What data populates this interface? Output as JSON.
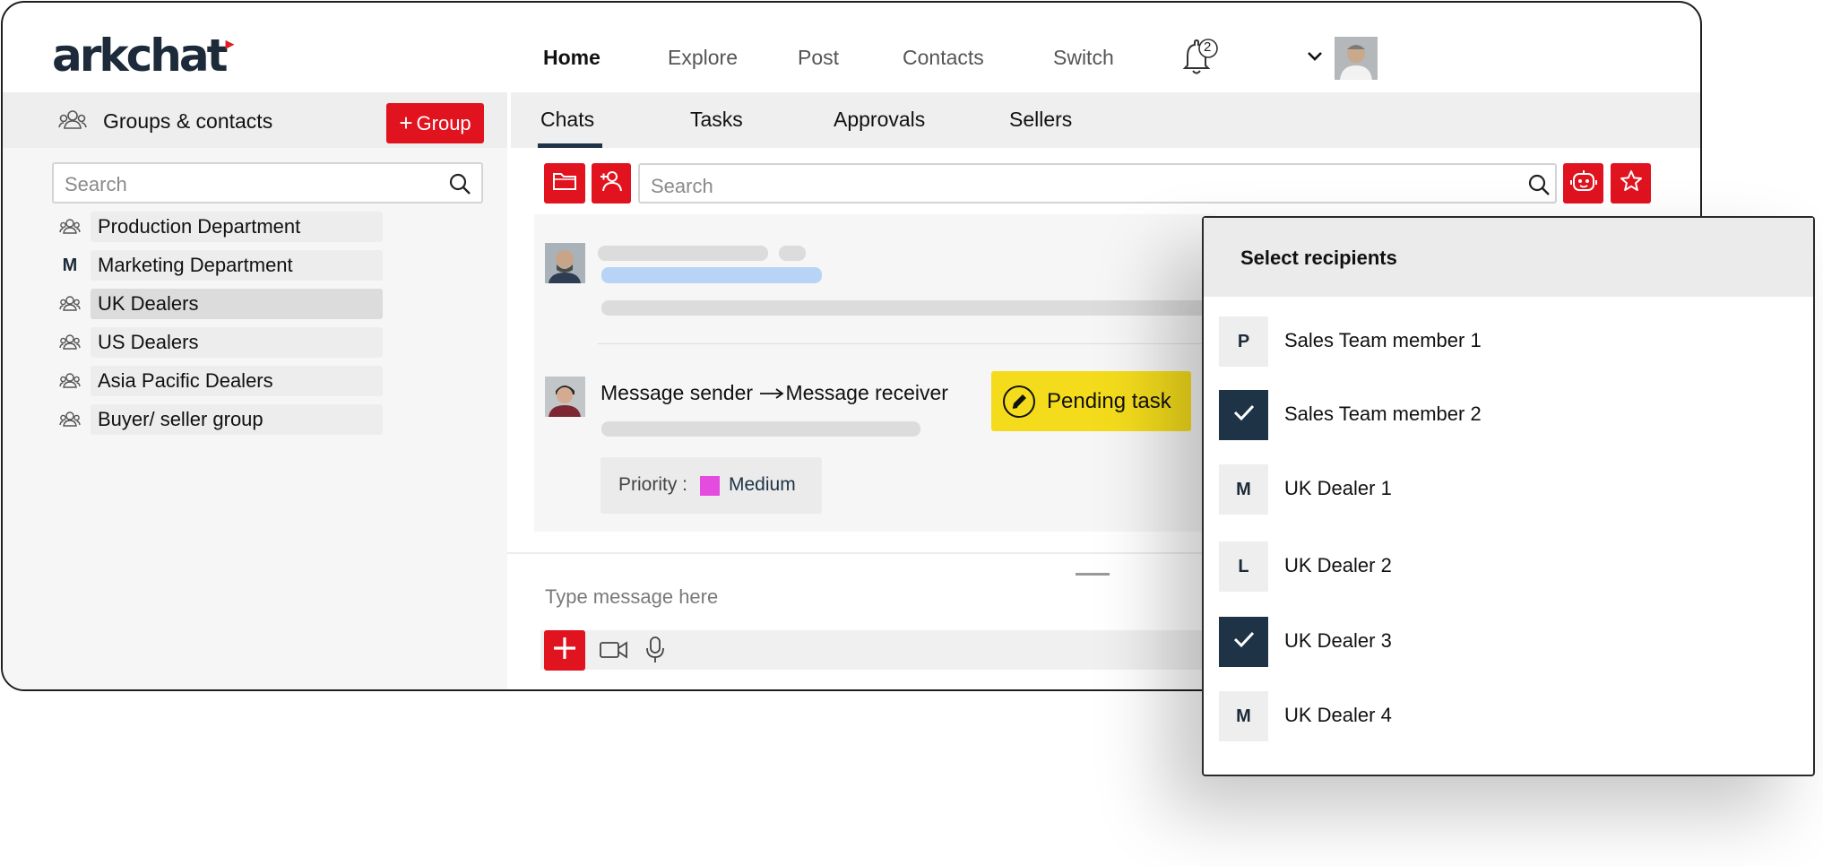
{
  "header": {
    "logo": "arkchat",
    "nav": [
      "Home",
      "Explore",
      "Post",
      "Contacts",
      "Switch"
    ],
    "notification_count": "2"
  },
  "sidebar": {
    "title": "Groups & contacts",
    "add_group_label": "Group",
    "search_placeholder": "Search",
    "items": [
      {
        "label": "Production Department",
        "icon": "group-icon"
      },
      {
        "label": "Marketing Department",
        "icon": "M"
      },
      {
        "label": "UK Dealers",
        "icon": "group-icon"
      },
      {
        "label": "US Dealers",
        "icon": "group-icon"
      },
      {
        "label": "Asia Pacific Dealers",
        "icon": "group-icon"
      },
      {
        "label": "Buyer/ seller group",
        "icon": "group-icon"
      }
    ]
  },
  "main": {
    "tabs": [
      "Chats",
      "Tasks",
      "Approvals",
      "Sellers"
    ],
    "search_placeholder": "Search",
    "message": {
      "sender_text": "Message sender",
      "receiver_text": "Message receiver",
      "task_label": "Pending task",
      "priority_label": "Priority :",
      "priority_value": "Medium",
      "priority_color": "#e44ce0"
    },
    "composer_placeholder": "Type message here"
  },
  "popup": {
    "title": "Select recipients",
    "recipients": [
      {
        "initial": "P",
        "name": "Sales Team member 1",
        "checked": false
      },
      {
        "initial": "",
        "name": "Sales Team member 2",
        "checked": true
      },
      {
        "initial": "M",
        "name": "UK Dealer 1",
        "checked": false
      },
      {
        "initial": "L",
        "name": "UK Dealer 2",
        "checked": false
      },
      {
        "initial": "",
        "name": "UK Dealer 3",
        "checked": true
      },
      {
        "initial": "M",
        "name": "UK Dealer 4",
        "checked": false
      }
    ]
  },
  "colors": {
    "accent": "#e0131f",
    "navy": "#1e3345",
    "task_yellow": "#f4dc1c",
    "link_blue": "#b9d3f7"
  }
}
